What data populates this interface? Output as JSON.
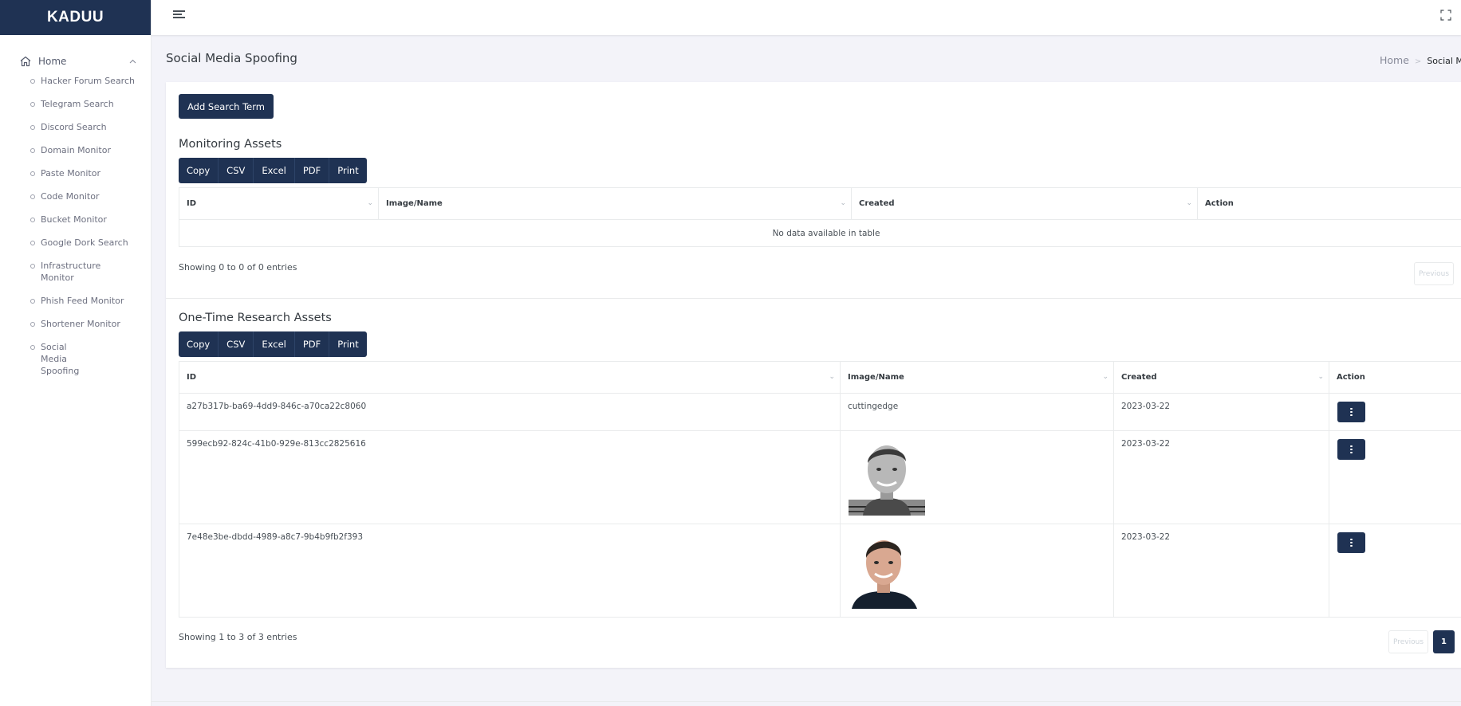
{
  "brand": "KADUU",
  "sidebar": {
    "home_label": "Home",
    "items": [
      {
        "label": "Hacker Forum Search"
      },
      {
        "label": "Telegram Search"
      },
      {
        "label": "Discord Search"
      },
      {
        "label": "Domain Monitor"
      },
      {
        "label": "Paste Monitor"
      },
      {
        "label": "Code Monitor"
      },
      {
        "label": "Bucket Monitor"
      },
      {
        "label": "Google Dork Search"
      },
      {
        "label": "Infrastructure Monitor"
      },
      {
        "label": "Phish Feed Monitor"
      },
      {
        "label": "Shortener Monitor"
      },
      {
        "label": "Social Media Spoofing"
      }
    ]
  },
  "page": {
    "title": "Social Media Spoofing",
    "breadcrumb": {
      "home": "Home",
      "current": "Social M"
    }
  },
  "add_button": "Add Search Term",
  "export_buttons": [
    "Copy",
    "CSV",
    "Excel",
    "PDF",
    "Print"
  ],
  "monitoring": {
    "title": "Monitoring Assets",
    "columns": [
      "ID",
      "Image/Name",
      "Created",
      "Action"
    ],
    "empty_text": "No data available in table",
    "info": "Showing 0 to 0 of 0 entries",
    "prev": "Previous"
  },
  "research": {
    "title": "One-Time Research Assets",
    "columns": [
      "ID",
      "Image/Name",
      "Created",
      "Action"
    ],
    "rows": [
      {
        "id": "a27b317b-ba69-4dd9-846c-a70ca22c8060",
        "name": "cuttingedge",
        "image": null,
        "created": "2023-03-22"
      },
      {
        "id": "599ecb92-824c-41b0-929e-813cc2825616",
        "name": "",
        "image": "face-portrait-grayscale",
        "created": "2023-03-22"
      },
      {
        "id": "7e48e3be-dbdd-4989-a8c7-9b4b9fb2f393",
        "name": "",
        "image": "face-portrait-color",
        "created": "2023-03-22"
      }
    ],
    "info": "Showing 1 to 3 of 3 entries",
    "prev": "Previous",
    "page": "1"
  },
  "colors": {
    "primary": "#1f3253",
    "background": "#f3f3f9"
  }
}
